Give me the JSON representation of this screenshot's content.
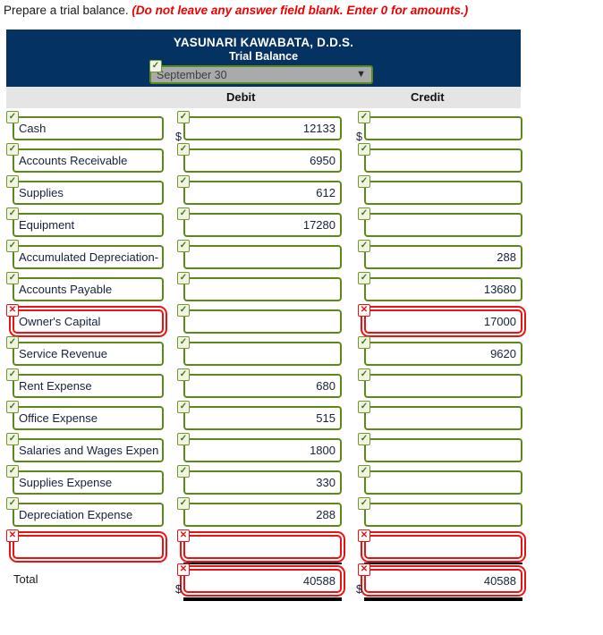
{
  "instruction": {
    "lead": "Prepare a trial balance.",
    "hint": "(Do not leave any answer field blank. Enter 0 for amounts.)"
  },
  "statement": {
    "company": "YASUNARI KAWABATA, D.D.S.",
    "title": "Trial Balance",
    "period_select": {
      "value": "September 30",
      "caret": "chevron-down-icon",
      "status": "ok"
    },
    "columns": {
      "account": "",
      "debit": "Debit",
      "credit": "Credit"
    },
    "total_label": "Total",
    "currency_symbol": "$",
    "badge_ok": "✓",
    "badge_bad": "✕",
    "rows": [
      {
        "account": "Cash",
        "account_status": "ok",
        "debit": "12133",
        "debit_status": "ok",
        "credit": "",
        "credit_status": "ok",
        "debit_dollar": true,
        "credit_dollar": true
      },
      {
        "account": "Accounts Receivable",
        "account_status": "ok",
        "debit": "6950",
        "debit_status": "ok",
        "credit": "",
        "credit_status": "ok",
        "debit_dollar": false,
        "credit_dollar": false
      },
      {
        "account": "Supplies",
        "account_status": "ok",
        "debit": "612",
        "debit_status": "ok",
        "credit": "",
        "credit_status": "ok",
        "debit_dollar": false,
        "credit_dollar": false
      },
      {
        "account": "Equipment",
        "account_status": "ok",
        "debit": "17280",
        "debit_status": "ok",
        "credit": "",
        "credit_status": "ok",
        "debit_dollar": false,
        "credit_dollar": false
      },
      {
        "account": "Accumulated Depreciation-",
        "account_status": "ok",
        "debit": "",
        "debit_status": "ok",
        "credit": "288",
        "credit_status": "ok",
        "debit_dollar": false,
        "credit_dollar": false
      },
      {
        "account": "Accounts Payable",
        "account_status": "ok",
        "debit": "",
        "debit_status": "ok",
        "credit": "13680",
        "credit_status": "ok",
        "debit_dollar": false,
        "credit_dollar": false
      },
      {
        "account": "Owner's Capital",
        "account_status": "bad",
        "debit": "",
        "debit_status": "ok",
        "credit": "17000",
        "credit_status": "bad",
        "debit_dollar": false,
        "credit_dollar": false
      },
      {
        "account": "Service Revenue",
        "account_status": "ok",
        "debit": "",
        "debit_status": "ok",
        "credit": "9620",
        "credit_status": "ok",
        "debit_dollar": false,
        "credit_dollar": false
      },
      {
        "account": "Rent Expense",
        "account_status": "ok",
        "debit": "680",
        "debit_status": "ok",
        "credit": "",
        "credit_status": "ok",
        "debit_dollar": false,
        "credit_dollar": false
      },
      {
        "account": "Office Expense",
        "account_status": "ok",
        "debit": "515",
        "debit_status": "ok",
        "credit": "",
        "credit_status": "ok",
        "debit_dollar": false,
        "credit_dollar": false
      },
      {
        "account": "Salaries and Wages Expen",
        "account_status": "ok",
        "debit": "1800",
        "debit_status": "ok",
        "credit": "",
        "credit_status": "ok",
        "debit_dollar": false,
        "credit_dollar": false
      },
      {
        "account": "Supplies Expense",
        "account_status": "ok",
        "debit": "330",
        "debit_status": "ok",
        "credit": "",
        "credit_status": "ok",
        "debit_dollar": false,
        "credit_dollar": false
      },
      {
        "account": "Depreciation Expense",
        "account_status": "ok",
        "debit": "288",
        "debit_status": "ok",
        "credit": "",
        "credit_status": "ok",
        "debit_dollar": false,
        "credit_dollar": false
      },
      {
        "account": "",
        "account_status": "bad",
        "debit": "",
        "debit_status": "bad",
        "credit": "",
        "credit_status": "bad",
        "debit_dollar": false,
        "credit_dollar": false
      }
    ],
    "total_row": {
      "debit": "40588",
      "debit_status": "bad",
      "credit": "40588",
      "credit_status": "bad",
      "debit_dollar": true,
      "credit_dollar": true
    }
  }
}
